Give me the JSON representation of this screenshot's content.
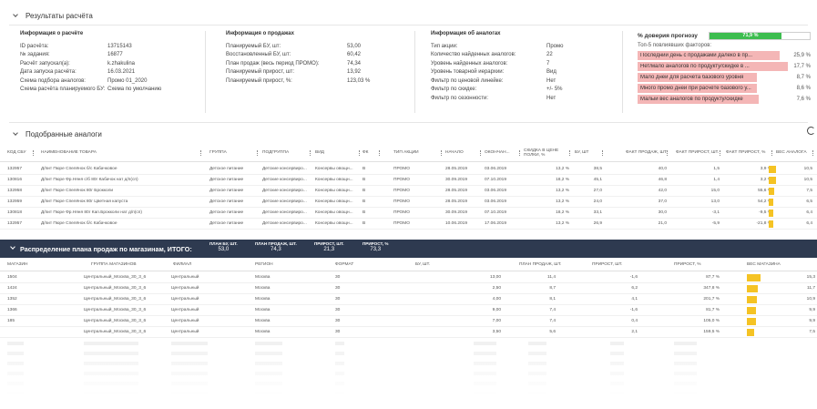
{
  "sections": {
    "results_title": "Результаты расчёта",
    "analogs_title": "Подобранные аналоги",
    "distribution_title": "Распределение плана продаж по магазинам, ИТОГО:"
  },
  "order_info": {
    "title": "Информация о расчёте",
    "rows": [
      {
        "k": "ID расчёта:",
        "v": "13715143"
      },
      {
        "k": "№ задания:",
        "v": "16877"
      },
      {
        "k": "Расчёт запускал(а):",
        "v": "k.zhakulina"
      },
      {
        "k": "Дата запуска расчёта:",
        "v": "16.03.2021"
      },
      {
        "k": "Схема подбора аналогов:",
        "v": "Промо 01_2020"
      },
      {
        "k": "Схема расчёта планируемого БУ:",
        "v": "Схема по умолчанию"
      }
    ]
  },
  "sales_info": {
    "title": "Информация о продажах",
    "rows": [
      {
        "k": "Планируемый БУ, шт:",
        "v": "53,00"
      },
      {
        "k": "Восстановленный БУ, шт:",
        "v": "60,42"
      },
      {
        "k": "План продаж (весь период ПРОМО):",
        "v": "74,34"
      },
      {
        "k": "Планируемый прирост, шт:",
        "v": "13,92"
      },
      {
        "k": "Планируемый прирост, %:",
        "v": "123,03 %"
      }
    ]
  },
  "analog_info": {
    "title": "Информация об аналогах",
    "rows": [
      {
        "k": "Тип акции:",
        "v": "Промо"
      },
      {
        "k": "Количество найденных аналогов:",
        "v": "22"
      },
      {
        "k": "Уровень найденных аналогов:",
        "v": "7"
      },
      {
        "k": "Уровень товарной иерархии:",
        "v": "Вид"
      },
      {
        "k": "Фильтр по ценовой линейке:",
        "v": "Нет"
      },
      {
        "k": "Фильтр по скидке:",
        "v": "+/- 5%"
      },
      {
        "k": "Фильтр по сезонности:",
        "v": "Нет"
      }
    ]
  },
  "trust": {
    "title": "% доверия прогнозу",
    "value": "71,9 %",
    "fraction": 0.719,
    "subtitle": "Топ-5 повлиявших факторов:",
    "factors": [
      {
        "label": "Последний день с продажами далеко в пр...",
        "value": "25,9 %",
        "fraction": 0.93
      },
      {
        "label": "Нет/мало аналогов по продукту/скидке в ...",
        "value": "17,7 %",
        "fraction": 0.98
      },
      {
        "label": "Мало дней для расчёта базового уровня",
        "value": "8,7 %",
        "fraction": 0.78
      },
      {
        "label": "Много промо дней при расчёте базового у...",
        "value": "8,6 %",
        "fraction": 0.78
      },
      {
        "label": "Малый вес аналогов по продукту/скидке",
        "value": "7,6 %",
        "fraction": 0.79
      }
    ]
  },
  "analogs_table": {
    "headers": [
      "КОД СБУ",
      "НАИМЕНОВАНИЕ ТОВАРА",
      "ГРУППА",
      "ПОДГРУППА",
      "ВИД",
      "ФК",
      "ТИП АКЦИИ",
      "НАЧАЛО",
      "ОКОНЧАН...",
      "СКИДКА В ЦЕНЕ ПОЛКИ, %",
      "БУ, ШТ",
      "ФАКТ ПРОДАЖ, ШТ.",
      "ФАКТ ПРИРОСТ, ШТ.",
      "ФАКТ ПРИРОСТ, %",
      "ВЕС АНАЛОГА"
    ],
    "rows": [
      [
        "132957",
        "Д/пит Пюре Спелёнок б/с Кабачковое",
        "Детское питание",
        "Детские консервиро...",
        "Консервы овощн...",
        "В",
        "ПРОМО",
        "28.05.2019",
        "03.06.2019",
        "13,2 %",
        "38,5",
        "40,0",
        "1,5",
        "3,9 %",
        "10,5",
        0.9
      ],
      [
        "130816",
        "Д/пит Пюре Фр.Няня с/б 80г Кабачок нат д/п(сп)",
        "Детское питание",
        "Детские консервиро...",
        "Консервы овощн...",
        "В",
        "ПРОМО",
        "30.09.2019",
        "07.10.2019",
        "18,2 %",
        "45,1",
        "46,8",
        "1,4",
        "3,2 %",
        "10,5",
        0.9
      ],
      [
        "132958",
        "Д/пит Пюре Спелёнок 80г Брокколи",
        "Детское питание",
        "Детские консервиро...",
        "Консервы овощн...",
        "В",
        "ПРОМО",
        "28.05.2019",
        "03.06.2019",
        "13,2 %",
        "27,0",
        "42,0",
        "15,0",
        "55,6 %",
        "7,5",
        0.65
      ],
      [
        "132959",
        "Д/пит Пюре Спелёнок 80г Цветная капуста",
        "Детское питание",
        "Детские консервиро...",
        "Консервы овощн...",
        "В",
        "ПРОМО",
        "28.05.2019",
        "03.06.2019",
        "13,2 %",
        "24,0",
        "37,0",
        "13,0",
        "54,2 %",
        "6,5",
        0.55
      ],
      [
        "130818",
        "Д/пит Пюре Фр.Няня 80г Кап.Брокколи нат д/п(сп)",
        "Детское питание",
        "Детские консервиро...",
        "Консервы овощн...",
        "В",
        "ПРОМО",
        "30.09.2019",
        "07.10.2019",
        "18,2 %",
        "33,1",
        "30,0",
        "-3,1",
        "-9,5 %",
        "6,4",
        0.55
      ],
      [
        "132957",
        "Д/пит Пюре Спелёнок б/с Кабачковое",
        "Детское питание",
        "Детские консервиро...",
        "Консервы овощн...",
        "В",
        "ПРОМО",
        "10.06.2019",
        "17.06.2019",
        "13,2 %",
        "26,9",
        "21,0",
        "-5,9",
        "-21,8 %",
        "6,4",
        0.55
      ]
    ]
  },
  "distribution": {
    "metrics": [
      {
        "label": "ПЛАН БУ, ШТ.",
        "value": "53,0"
      },
      {
        "label": "ПЛАН ПРОДАЖ, ШТ.",
        "value": "74,3"
      },
      {
        "label": "ПРИРОСТ, ШТ.",
        "value": "21,3"
      },
      {
        "label": "ПРИРОСТ, %",
        "value": "73,3"
      }
    ],
    "headers": [
      "МАГАЗИН",
      "ГРУППА МАГАЗИНОВ",
      "ФИЛИАЛ",
      "РЕГИОН",
      "ФОРМАТ",
      "БУ, ШТ.",
      "ПЛАН ПРОДАЖ, ШТ.",
      "ПРИРОСТ, ШТ.",
      "ПРИРОСТ, %",
      "ВЕС МАГАЗИНА"
    ],
    "rows": [
      [
        "1504",
        "Центральный_Москва_30_3_6",
        "Центральный",
        "Москва",
        "30",
        "13,00",
        "11,4",
        "-1,6",
        "87,7 %",
        "15,3",
        0.95
      ],
      [
        "1424",
        "Центральный_Москва_30_3_6",
        "Центральный",
        "Москва",
        "30",
        "2,50",
        "8,7",
        "6,2",
        "347,8 %",
        "11,7",
        0.75
      ],
      [
        "1352",
        "Центральный_Москва_30_3_6",
        "Центральный",
        "Москва",
        "30",
        "4,00",
        "8,1",
        "4,1",
        "201,7 %",
        "10,9",
        0.7
      ],
      [
        "1366",
        "Центральный_Москва_30_3_6",
        "Центральный",
        "Москва",
        "30",
        "9,00",
        "7,4",
        "-1,6",
        "81,7 %",
        "9,9",
        0.65
      ],
      [
        "185",
        "Центральный_Москва_30_3_6",
        "Центральный",
        "Москва",
        "30",
        "7,00",
        "7,4",
        "0,4",
        "105,0 %",
        "9,9",
        0.65
      ],
      [
        "",
        "Центральный_Москва_30_3_6",
        "Центральный",
        "Москва",
        "30",
        "3,50",
        "5,6",
        "2,1",
        "159,5 %",
        "7,5",
        0.5
      ]
    ]
  }
}
